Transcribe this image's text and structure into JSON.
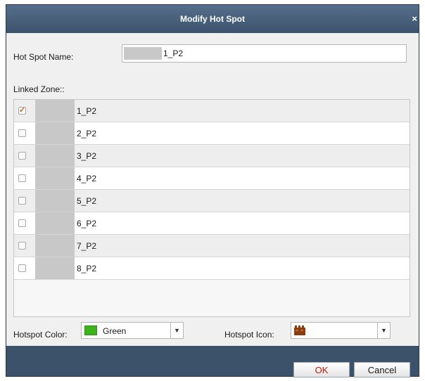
{
  "dialog": {
    "title": "Modify Hot Spot",
    "close_glyph": "×",
    "hot_spot_name_label": "Hot Spot Name:",
    "hot_spot_name_value": "1_P2",
    "linked_zone_label": "Linked Zone::",
    "zones": [
      {
        "label": "1_P2",
        "checked": true
      },
      {
        "label": "2_P2",
        "checked": false
      },
      {
        "label": "3_P2",
        "checked": false
      },
      {
        "label": "4_P2",
        "checked": false
      },
      {
        "label": "5_P2",
        "checked": false
      },
      {
        "label": "6_P2",
        "checked": false
      },
      {
        "label": "7_P2",
        "checked": false
      },
      {
        "label": "8_P2",
        "checked": false
      }
    ],
    "hotspot_color_label": "Hotspot Color:",
    "hotspot_color_value": "Green",
    "hotspot_color_hex": "#3cb21d",
    "hotspot_icon_label": "Hotspot Icon:",
    "hotspot_icon_name": "fence-icon",
    "ok_label": "OK",
    "cancel_label": "Cancel"
  }
}
